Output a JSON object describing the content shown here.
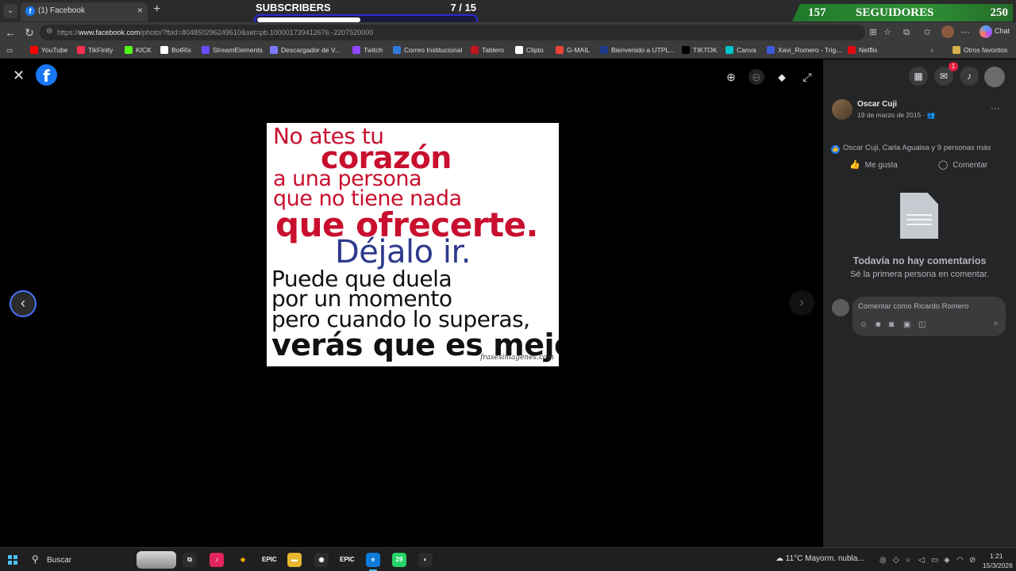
{
  "browser": {
    "tab": {
      "title": "(1) Facebook",
      "favicon": "facebook-icon"
    },
    "url": {
      "prefix": "https://",
      "host": "www.facebook.com",
      "path": "/photo/?fbid=804850296249610&set=pb.100001739412676.-2207520000"
    },
    "chat_label": "Chat",
    "bookmarks": [
      {
        "label": "YouTube",
        "color": "#ff0000"
      },
      {
        "label": "TikFinity",
        "color": "#ff2d55"
      },
      {
        "label": "KICK",
        "color": "#53fc18"
      },
      {
        "label": "BotRix",
        "color": "#ffffff"
      },
      {
        "label": "StreamElements",
        "color": "#6a4cff"
      },
      {
        "label": "Descargador de V...",
        "color": "#7a7aff"
      },
      {
        "label": "Twitch",
        "color": "#9146ff"
      },
      {
        "label": "Correo Institucional",
        "color": "#2f7bd8"
      },
      {
        "label": "Tablero",
        "color": "#c4161c"
      },
      {
        "label": "Clipto",
        "color": "#ffffff"
      },
      {
        "label": "G-MAIL",
        "color": "#ea4335"
      },
      {
        "label": "Bienvenido a UTPL...",
        "color": "#1e3a8a"
      },
      {
        "label": "TIKTOK",
        "color": "#000000"
      },
      {
        "label": "Canva",
        "color": "#00c4cc"
      },
      {
        "label": "Xavi_Romero - Trig...",
        "color": "#3b5bdb"
      },
      {
        "label": "Netflix",
        "color": "#e50914"
      }
    ],
    "other_favorites": "Otros favoritos"
  },
  "overlays": {
    "subscribers": {
      "label": "SUBSCRIBERS",
      "count": "7  / 15",
      "progress": 0.467
    },
    "followers": {
      "left": "157",
      "label": "SEGUIDORES",
      "right": "250"
    }
  },
  "viewer": {
    "photo_lines": [
      "No ates tu",
      "corazón",
      "a una persona",
      "que no tiene nada",
      "que ofrecerte.",
      "Déjalo ir.",
      "Puede que duela",
      "por un momento",
      "pero cuando lo superas,",
      "verás que es mejor."
    ],
    "watermark": "frasesimagenes.com"
  },
  "panel": {
    "author": "Oscar Cuji",
    "date": "19 de marzo de 2015 · ",
    "reactions": "Oscar Cuji, Carla Aguaisa y 9 personas más",
    "like_label": "Me gusta",
    "comment_label": "Comentar",
    "no_comments": "Todavía no hay comentarios",
    "be_first": "Sé la primera persona en comentar.",
    "comment_placeholder": "Comentar como Ricardo Romero",
    "notification_count": "1"
  },
  "taskbar": {
    "search_label": "Buscar",
    "whatsapp_badge": "29",
    "weather": "11°C  Mayorm. nubla...",
    "time": "1:21",
    "date": "15/3/2026"
  },
  "colors": {
    "facebook_blue": "#1877f2",
    "panel_bg": "#242526",
    "photo_red": "#c8102e",
    "photo_blue": "#2d3a8c"
  }
}
